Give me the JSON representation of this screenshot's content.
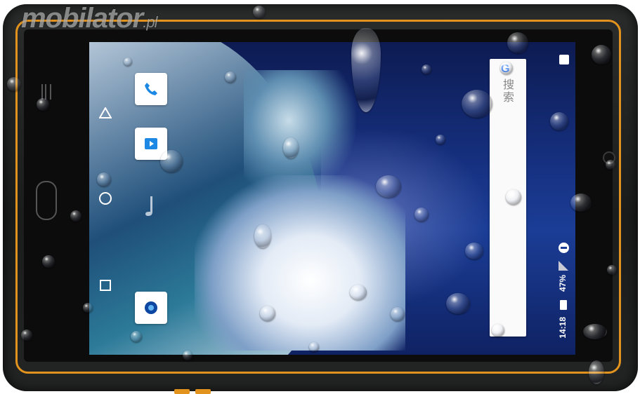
{
  "watermark": {
    "brand": "mobilator",
    "domain": ".pl"
  },
  "status_bar": {
    "battery_percent": "47%",
    "time": "14:18"
  },
  "search_widget": {
    "label": "搜索",
    "logo": "G"
  },
  "dock": {
    "apps": [
      "phone-app-icon",
      "video-player-app-icon",
      "music-app-icon",
      "camera-app-icon"
    ]
  },
  "nav_bar": {
    "buttons": [
      "back-icon",
      "home-icon",
      "recents-icon"
    ]
  },
  "colors": {
    "trim": "#e2931d",
    "screen": "#1b3d96",
    "body": "#1f2020"
  }
}
